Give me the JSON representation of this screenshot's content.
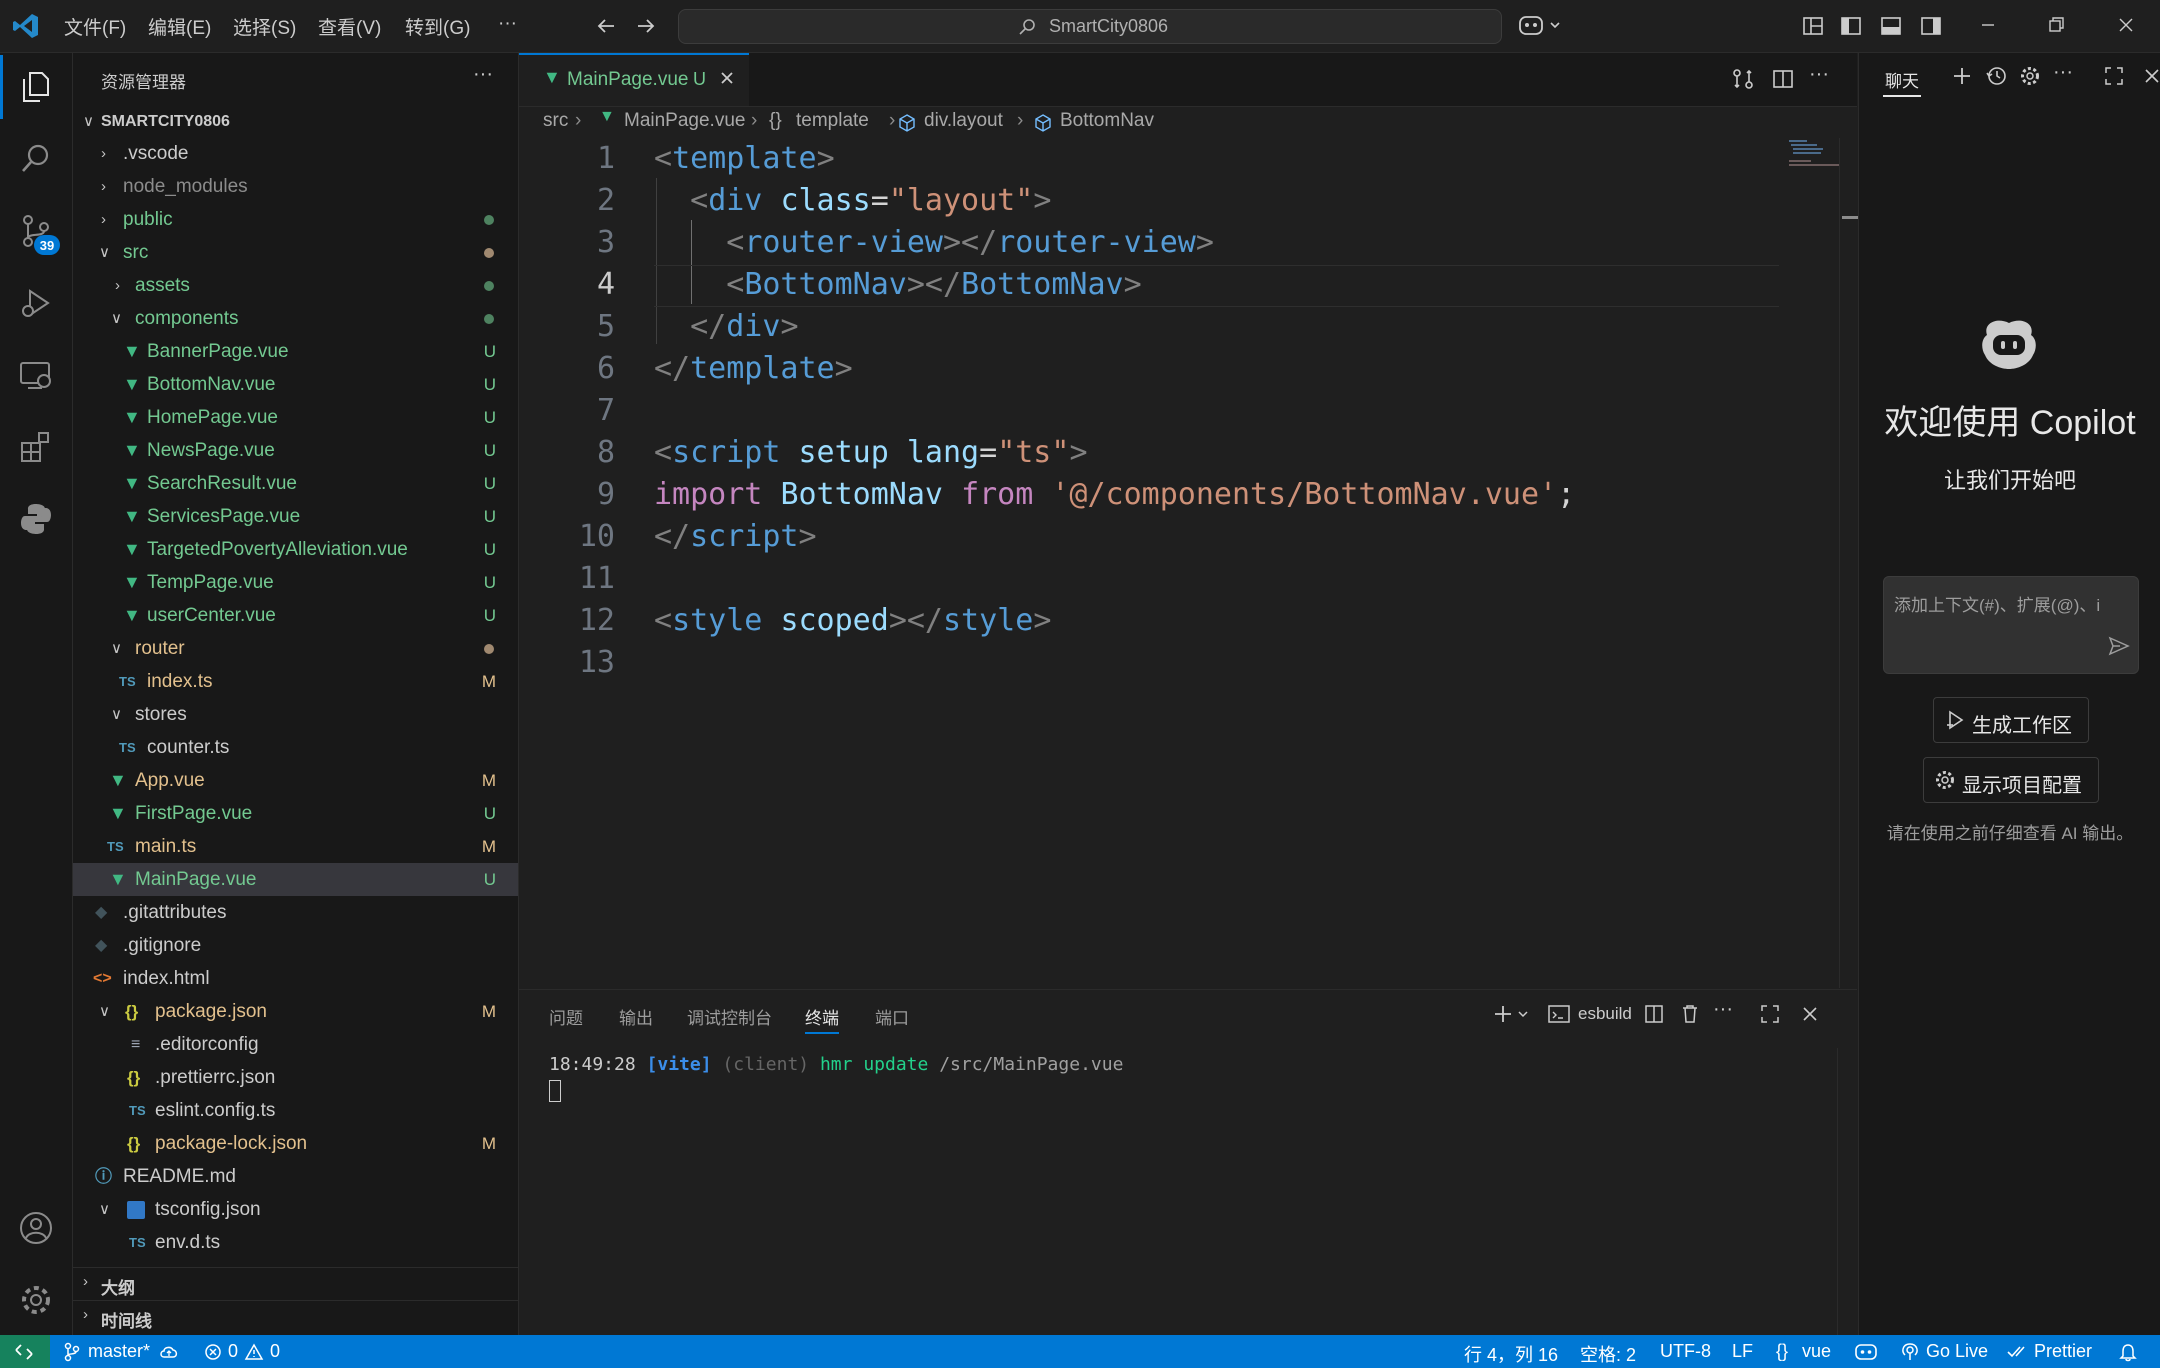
{
  "titlebar": {
    "menus": [
      "文件(F)",
      "编辑(E)",
      "选择(S)",
      "查看(V)",
      "转到(G)",
      "···"
    ],
    "search": "SmartCity0806"
  },
  "activity": {
    "scm_badge": "39"
  },
  "explorer": {
    "title": "资源管理器",
    "root": "SMARTCITY0806",
    "items": [
      {
        "label": ".vscode",
        "deco": ""
      },
      {
        "label": "node_modules",
        "deco": ""
      },
      {
        "label": "public",
        "deco": ""
      },
      {
        "label": "src",
        "deco": ""
      },
      {
        "label": "assets",
        "deco": ""
      },
      {
        "label": "components",
        "deco": ""
      },
      {
        "label": "BannerPage.vue",
        "deco": "U"
      },
      {
        "label": "BottomNav.vue",
        "deco": "U"
      },
      {
        "label": "HomePage.vue",
        "deco": "U"
      },
      {
        "label": "NewsPage.vue",
        "deco": "U"
      },
      {
        "label": "SearchResult.vue",
        "deco": "U"
      },
      {
        "label": "ServicesPage.vue",
        "deco": "U"
      },
      {
        "label": "TargetedPovertyAlleviation.vue",
        "deco": "U"
      },
      {
        "label": "TempPage.vue",
        "deco": "U"
      },
      {
        "label": "userCenter.vue",
        "deco": "U"
      },
      {
        "label": "router",
        "deco": ""
      },
      {
        "label": "index.ts",
        "deco": "M"
      },
      {
        "label": "stores",
        "deco": ""
      },
      {
        "label": "counter.ts",
        "deco": ""
      },
      {
        "label": "App.vue",
        "deco": "M"
      },
      {
        "label": "FirstPage.vue",
        "deco": "U"
      },
      {
        "label": "main.ts",
        "deco": "M"
      },
      {
        "label": "MainPage.vue",
        "deco": "U"
      },
      {
        "label": ".gitattributes",
        "deco": ""
      },
      {
        "label": ".gitignore",
        "deco": ""
      },
      {
        "label": "index.html",
        "deco": ""
      },
      {
        "label": "package.json",
        "deco": "M"
      },
      {
        "label": ".editorconfig",
        "deco": ""
      },
      {
        "label": ".prettierrc.json",
        "deco": ""
      },
      {
        "label": "eslint.config.ts",
        "deco": ""
      },
      {
        "label": "package-lock.json",
        "deco": "M"
      },
      {
        "label": "README.md",
        "deco": ""
      },
      {
        "label": "tsconfig.json",
        "deco": ""
      },
      {
        "label": "env.d.ts",
        "deco": ""
      }
    ],
    "outline": "大纲",
    "timeline": "时间线"
  },
  "editor": {
    "tab_label": "MainPage.vue",
    "tab_deco": "U",
    "breadcrumb": [
      "src",
      "MainPage.vue",
      "template",
      "div.layout",
      "BottomNav"
    ],
    "line_numbers": [
      "1",
      "2",
      "3",
      "4",
      "5",
      "6",
      "7",
      "8",
      "9",
      "10",
      "11",
      "12",
      "13"
    ]
  },
  "panel": {
    "tabs": [
      "问题",
      "输出",
      "调试控制台",
      "终端",
      "端口"
    ],
    "terminal_name": "esbuild",
    "log_time": "18:49:28",
    "log_tag": "[vite]",
    "log_client": "(client)",
    "log_action": "hmr update",
    "log_path": "/src/MainPage.vue"
  },
  "chat": {
    "tab": "聊天",
    "welcome": "欢迎使用 Copilot",
    "subtitle": "让我们开始吧",
    "input_placeholder": "添加上下文(#)、扩展(@)、i",
    "btn_workspace": "生成工作区",
    "btn_config": "显示项目配置",
    "disclaimer": "请在使用之前仔细查看 AI 输出。"
  },
  "status": {
    "branch": "master*",
    "errors": "0",
    "warnings": "0",
    "position": "行 4，列 16",
    "spaces": "空格: 2",
    "encoding": "UTF-8",
    "eol": "LF",
    "language": "vue",
    "golive": "Go Live",
    "prettier": "Prettier"
  },
  "colors": {
    "accent": "#0078d4",
    "untracked": "#73c991",
    "modified": "#e2c08d"
  }
}
